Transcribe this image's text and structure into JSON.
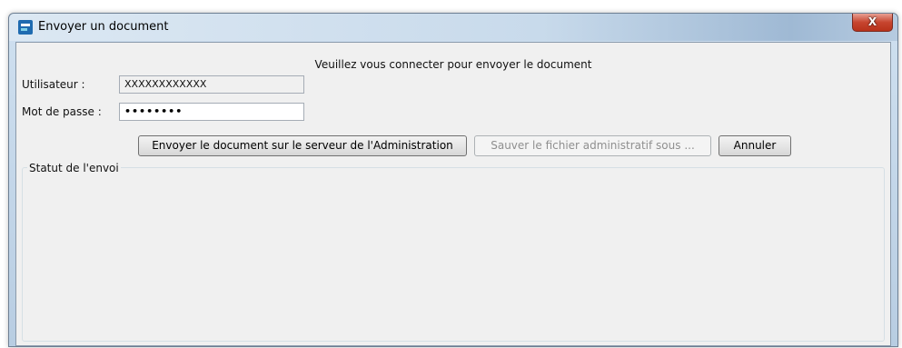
{
  "window": {
    "title": "Envoyer un document",
    "close_label": "X"
  },
  "form": {
    "prompt": "Veuillez vous connecter pour envoyer le document",
    "user_label": "Utilisateur :",
    "user_value": "XXXXXXXXXXXX",
    "password_label": "Mot de passe :",
    "password_value": "••••••••"
  },
  "buttons": {
    "send_label": "Envoyer le document sur le serveur de l'Administration",
    "save_label": "Sauver le fichier administratif sous ...",
    "cancel_label": "Annuler"
  },
  "status": {
    "title": "Statut de l'envoi"
  },
  "colors": {
    "titlebar": "#c8daeb",
    "close_button": "#c7452f",
    "client_background": "#f0f0f0"
  }
}
